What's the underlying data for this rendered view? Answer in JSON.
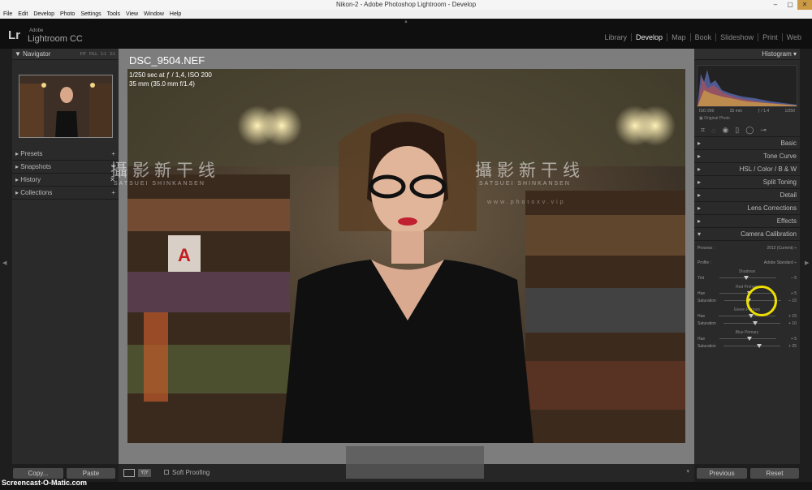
{
  "window": {
    "title": "Nikon-2 - Adobe Photoshop Lightroom - Develop",
    "min": "–",
    "max": "▢",
    "close": "✕"
  },
  "menu": [
    "File",
    "Edit",
    "Develop",
    "Photo",
    "Settings",
    "Tools",
    "View",
    "Window",
    "Help"
  ],
  "identity": {
    "logo": "Lr",
    "adobe": "Adobe",
    "product": "Lightroom CC"
  },
  "modules": [
    "Library",
    "Develop",
    "Map",
    "Book",
    "Slideshow",
    "Print",
    "Web"
  ],
  "active_module": "Develop",
  "left": {
    "navigator": {
      "title": "Navigator",
      "options": [
        "FIT",
        "FILL",
        "1:1",
        "3:1"
      ]
    },
    "sections": [
      {
        "label": "Presets",
        "action": "+"
      },
      {
        "label": "Snapshots",
        "action": "+"
      },
      {
        "label": "History",
        "action": "✕"
      },
      {
        "label": "Collections",
        "action": "+"
      }
    ],
    "copy_label": "Copy...",
    "paste_label": "Paste"
  },
  "photo": {
    "filename": "DSC_9504.NEF",
    "exposure": "1/250 sec at ƒ / 1,4, ISO 200",
    "lens": "35 mm (35.0 mm f/1.4)"
  },
  "watermark": {
    "chinese": "攝影新干线",
    "romaji": "SATSUEI SHINKANSEN",
    "url": "www.photoxv.vip"
  },
  "toolbar": {
    "soft_proofing": "Soft Proofing"
  },
  "right": {
    "histogram": {
      "title": "Histogram",
      "iso": "ISO 200",
      "focal": "35 mm",
      "aperture": "ƒ / 1.4",
      "shutter": "1/250",
      "original": "Original Photo"
    },
    "sections": [
      "Basic",
      "Tone Curve",
      "HSL / Color / B & W",
      "Split Toning",
      "Detail",
      "Lens Corrections",
      "Effects",
      "Camera Calibration"
    ],
    "calibration": {
      "process_label": "Process :",
      "process_value": "2012 (Current)",
      "profile_label": "Profile :",
      "profile_value": "Adobe Standard",
      "shadows": {
        "title": "Shadows",
        "tint_label": "Tint",
        "tint_value": "– 5"
      },
      "red": {
        "title": "Red Primary",
        "hue_label": "Hue",
        "hue_value": "+ 5",
        "sat_label": "Saturation",
        "sat_value": "– 15"
      },
      "green": {
        "title": "Green Primary",
        "hue_label": "Hue",
        "hue_value": "+ 15",
        "sat_label": "Saturation",
        "sat_value": "+ 10"
      },
      "blue": {
        "title": "Blue Primary",
        "hue_label": "Hue",
        "hue_value": "+ 5",
        "sat_label": "Saturation",
        "sat_value": "+ 25"
      }
    },
    "previous_label": "Previous",
    "reset_label": "Reset"
  },
  "screencast_label": "Screencast-O-Matic.com"
}
